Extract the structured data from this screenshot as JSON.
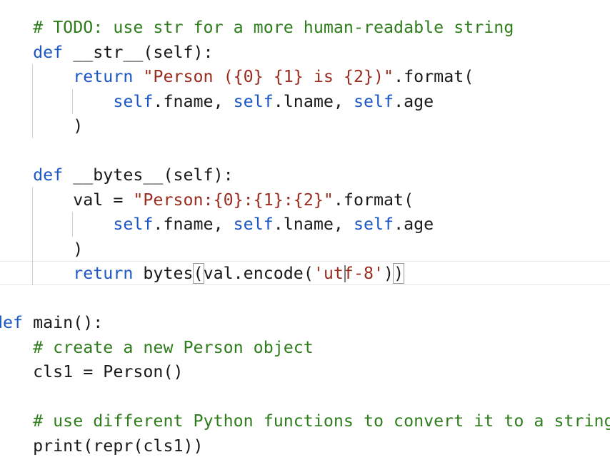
{
  "colors": {
    "keyword": "#1c57c4",
    "string": "#9a2d1f",
    "comment": "#2f7d1d",
    "text": "#1a1a1a",
    "background": "#ffffff"
  },
  "code": {
    "cursor_line": 11,
    "lines": [
      {
        "indent": "    ",
        "segments": [
          {
            "t": "# TODO: use str for a more human-readable string",
            "c": "cm"
          }
        ]
      },
      {
        "indent": "    ",
        "segments": [
          {
            "t": "def",
            "c": "kw"
          },
          {
            "t": " __str__(self):"
          }
        ]
      },
      {
        "indent": "        ",
        "segments": [
          {
            "t": "return",
            "c": "kw"
          },
          {
            "t": " "
          },
          {
            "t": "\"Person ({0} {1} is {2})\"",
            "c": "str"
          },
          {
            "t": ".format("
          }
        ]
      },
      {
        "indent": "            ",
        "segments": [
          {
            "t": "self",
            "c": "self"
          },
          {
            "t": ".fname, "
          },
          {
            "t": "self",
            "c": "self"
          },
          {
            "t": ".lname, "
          },
          {
            "t": "self",
            "c": "self"
          },
          {
            "t": ".age"
          }
        ]
      },
      {
        "indent": "        ",
        "segments": [
          {
            "t": ")"
          }
        ]
      },
      {
        "indent": "",
        "segments": []
      },
      {
        "indent": "    ",
        "segments": [
          {
            "t": "def",
            "c": "kw"
          },
          {
            "t": " __bytes__(self):"
          }
        ]
      },
      {
        "indent": "        ",
        "segments": [
          {
            "t": "val = "
          },
          {
            "t": "\"Person:{0}:{1}:{2}\"",
            "c": "str"
          },
          {
            "t": ".format("
          }
        ]
      },
      {
        "indent": "            ",
        "segments": [
          {
            "t": "self",
            "c": "self"
          },
          {
            "t": ".fname, "
          },
          {
            "t": "self",
            "c": "self"
          },
          {
            "t": ".lname, "
          },
          {
            "t": "self",
            "c": "self"
          },
          {
            "t": ".age"
          }
        ]
      },
      {
        "indent": "        ",
        "segments": [
          {
            "t": ")"
          }
        ]
      },
      {
        "indent": "        ",
        "segments": [
          {
            "t": "return",
            "c": "kw"
          },
          {
            "t": " bytes"
          },
          {
            "t": "(",
            "c": "bm"
          },
          {
            "t": "val.encode("
          },
          {
            "t": "'utf-8'",
            "c": "str"
          },
          {
            "t": ")"
          },
          {
            "t": ")",
            "c": "bm"
          }
        ]
      },
      {
        "indent": "",
        "segments": []
      },
      {
        "indent": "",
        "segments": [
          {
            "t": "def",
            "c": "kw"
          },
          {
            "t": " main():"
          }
        ]
      },
      {
        "indent": "    ",
        "segments": [
          {
            "t": "# create a new Person object",
            "c": "cm"
          }
        ]
      },
      {
        "indent": "    ",
        "segments": [
          {
            "t": "cls1 = Person()"
          }
        ]
      },
      {
        "indent": "",
        "segments": []
      },
      {
        "indent": "    ",
        "segments": [
          {
            "t": "# use different Python functions to convert it to a string",
            "c": "cm"
          }
        ]
      },
      {
        "indent": "    ",
        "segments": [
          {
            "t": "print(repr(cls1))"
          }
        ]
      }
    ]
  }
}
